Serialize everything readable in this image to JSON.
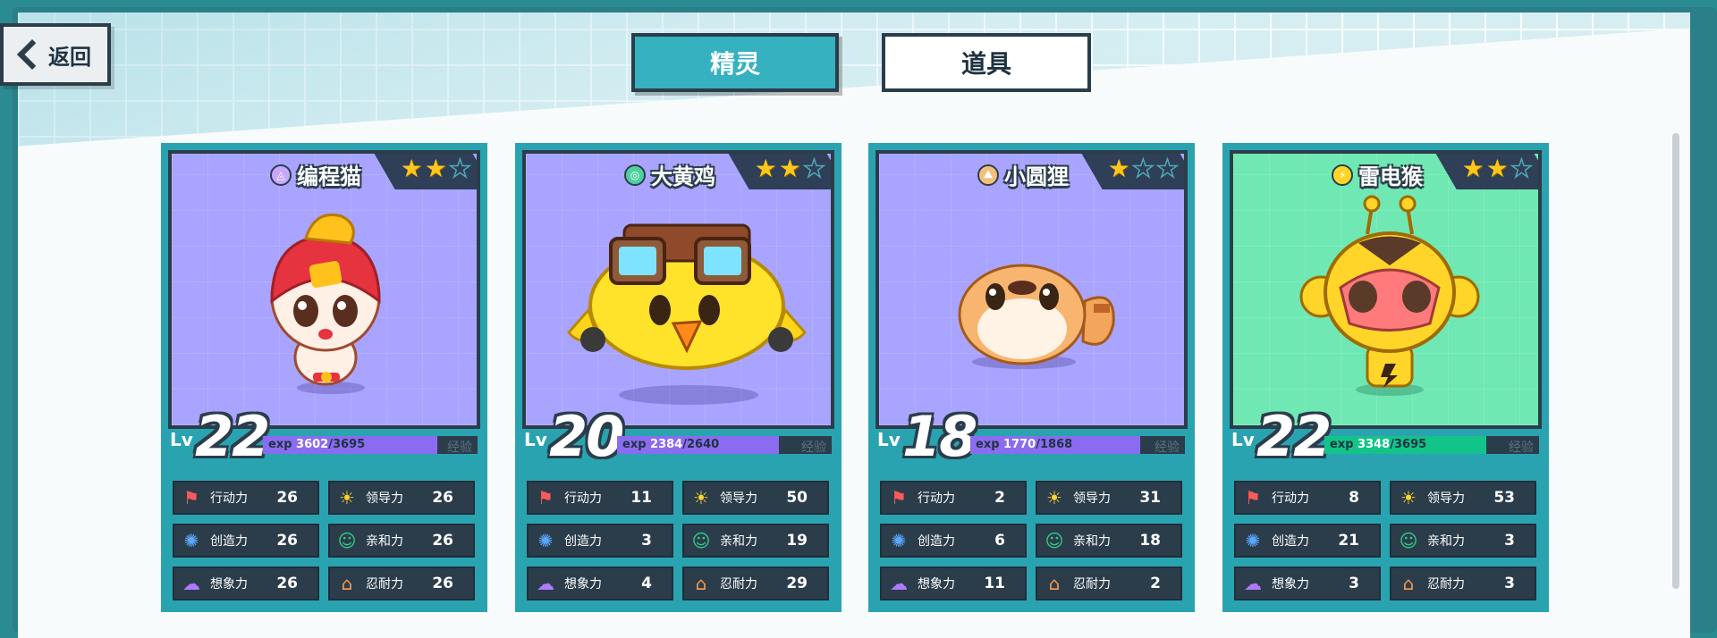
{
  "nav": {
    "back_label": "返回",
    "tabs": [
      {
        "label": "精灵",
        "active": true
      },
      {
        "label": "道具",
        "active": false
      }
    ]
  },
  "stat_labels": [
    "行动力",
    "领导力",
    "创造力",
    "亲和力",
    "想象力",
    "忍耐力"
  ],
  "cards": [
    {
      "name": "编程猫",
      "element": "magic",
      "bg": "#a9a4ff",
      "stars": 2,
      "max_stars": 3,
      "lv_label": "Lv",
      "level": "22",
      "exp_prefix": "exp",
      "exp_current": "3602",
      "exp_total": "/3695",
      "exp_fraction": 0.975,
      "exp_color": "#8a6cf0",
      "exp_word": "经验",
      "stats": [
        "26",
        "26",
        "26",
        "26",
        "26",
        "26"
      ]
    },
    {
      "name": "大黄鸡",
      "element": "wind",
      "bg": "#a9a4ff",
      "stars": 2,
      "max_stars": 3,
      "lv_label": "Lv",
      "level": "20",
      "exp_prefix": "exp",
      "exp_current": "2384",
      "exp_total": "/2640",
      "exp_fraction": 0.903,
      "exp_color": "#8a6cf0",
      "exp_word": "经验",
      "stats": [
        "11",
        "50",
        "3",
        "19",
        "4",
        "29"
      ]
    },
    {
      "name": "小圆狸",
      "element": "earth",
      "bg": "#a9a4ff",
      "stars": 1,
      "max_stars": 3,
      "lv_label": "Lv",
      "level": "18",
      "exp_prefix": "exp",
      "exp_current": "1770",
      "exp_total": "/1868",
      "exp_fraction": 0.948,
      "exp_color": "#8a6cf0",
      "exp_word": "经验",
      "stats": [
        "2",
        "31",
        "6",
        "18",
        "11",
        "2"
      ]
    },
    {
      "name": "雷电猴",
      "element": "thunder",
      "bg": "#6fe8b3",
      "stars": 2,
      "max_stars": 3,
      "lv_label": "Lv",
      "level": "22",
      "exp_prefix": "exp",
      "exp_current": "3348",
      "exp_total": "/3695",
      "exp_fraction": 0.906,
      "exp_color": "#12c48a",
      "exp_word": "经验",
      "stats": [
        "8",
        "53",
        "21",
        "3",
        "3",
        "3"
      ]
    }
  ]
}
